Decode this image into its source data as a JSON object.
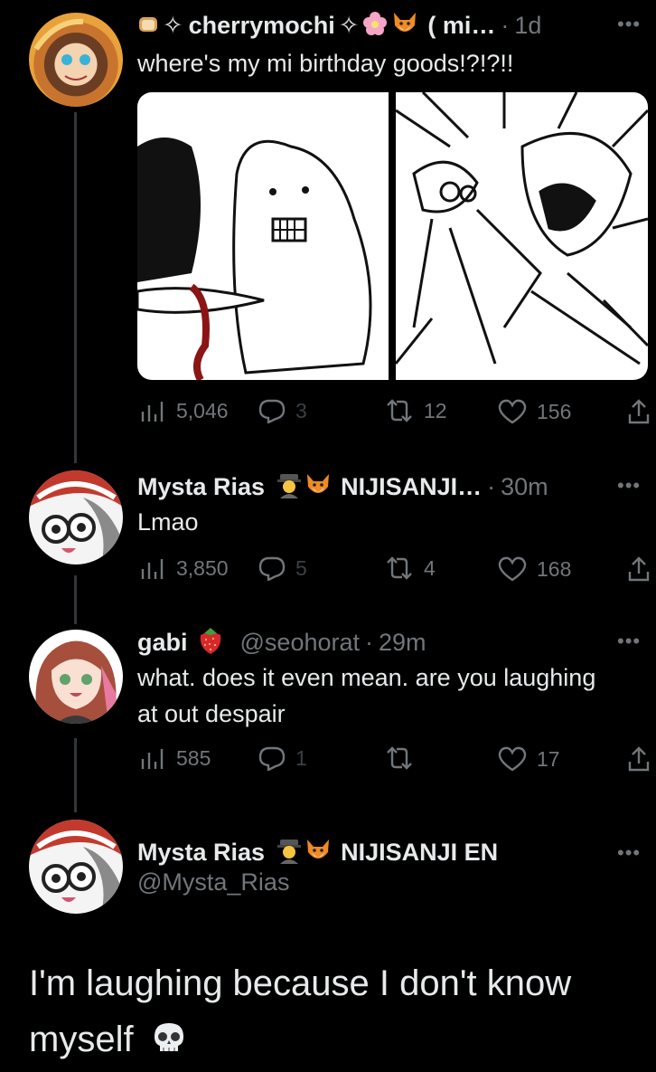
{
  "tweets": [
    {
      "name": "cherrymochi",
      "name_deco_left": "✧",
      "name_deco_right": "✧",
      "handle_truncated": "( mi…",
      "time": "1d",
      "text": "where's my mi birthday goods!?!?!!",
      "avatar_color": "#c9742e",
      "stats": {
        "views": "5,046",
        "replies": "3",
        "reposts": "12",
        "likes": "156"
      }
    },
    {
      "name": "Mysta Rias",
      "affiliation_truncated": "NIJISANJI…",
      "time": "30m",
      "text": "Lmao",
      "avatar_color": "#c9413a",
      "stats": {
        "views": "3,850",
        "replies": "5",
        "reposts": "4",
        "likes": "168"
      }
    },
    {
      "name": "gabi",
      "handle": "@seohorat",
      "time": "29m",
      "text": "what. does it even mean. are you laughing at out despair",
      "avatar_color": "#d77a8f",
      "stats": {
        "views": "585",
        "replies": "1",
        "reposts": "",
        "likes": "17"
      }
    }
  ],
  "focused": {
    "name": "Mysta Rias",
    "affiliation": "NIJISANJI EN",
    "handle": "@Mysta_Rias",
    "text": "I'm laughing because I don't know myself"
  },
  "colors": {
    "background": "#000000",
    "text": "#e7e9ea",
    "muted": "#71767b",
    "thread_line": "#333639"
  },
  "icons": [
    "bread-emoji",
    "flower-emoji",
    "fox-emoji",
    "detective-emoji",
    "strawberry-emoji",
    "skull-emoji",
    "views-icon",
    "reply-icon",
    "repost-icon",
    "like-icon",
    "share-icon",
    "more-icon"
  ]
}
